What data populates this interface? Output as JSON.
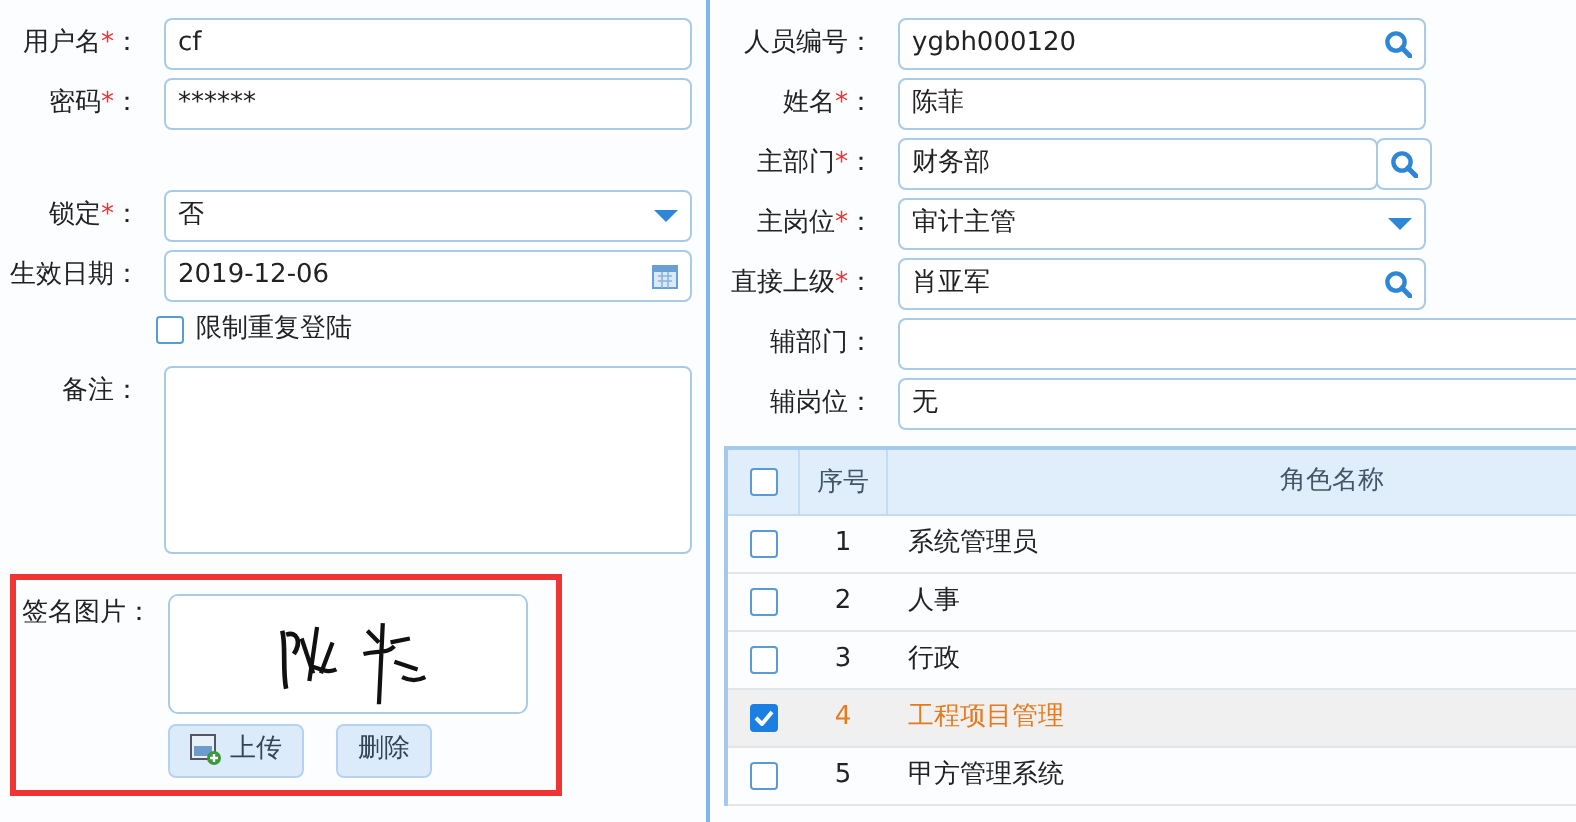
{
  "left_form": {
    "fields": [
      {
        "kind": "text",
        "label": "用户名",
        "required_mark": "*",
        "suffix": "：",
        "value": "cf"
      },
      {
        "kind": "password",
        "label": "密码",
        "required_mark": "*",
        "suffix": "：",
        "value": "******"
      },
      {
        "kind": "spacer"
      },
      {
        "kind": "select",
        "label": "锁定",
        "required_mark": "*",
        "suffix": "：",
        "value": "否"
      },
      {
        "kind": "date",
        "label": "生效日期",
        "suffix": "：",
        "value": "2019-12-06"
      },
      {
        "kind": "checkbox",
        "label": "限制重复登陆",
        "checked": false
      },
      {
        "kind": "textarea",
        "label": "备注",
        "suffix": "："
      }
    ],
    "signature": {
      "label": "签名图片：",
      "highlighted": true,
      "buttons": [
        {
          "kind": "upload",
          "label": "上传"
        },
        {
          "kind": "plain",
          "label": "删除"
        }
      ]
    }
  },
  "right_form": {
    "fields": [
      {
        "kind": "lookup",
        "label": "人员编号",
        "suffix": "：",
        "value": "ygbh000120"
      },
      {
        "kind": "text",
        "label": "姓名",
        "required_mark": "*",
        "suffix": "：",
        "value": "陈菲"
      },
      {
        "kind": "lookup_button",
        "label": "主部门",
        "required_mark": "*",
        "suffix": "：",
        "value": "财务部"
      },
      {
        "kind": "select",
        "label": "主岗位",
        "required_mark": "*",
        "suffix": "：",
        "value": "审计主管"
      },
      {
        "kind": "lookup",
        "label": "直接上级",
        "required_mark": "*",
        "suffix": "：",
        "value": "肖亚军"
      },
      {
        "kind": "wide",
        "label": "辅部门",
        "suffix": "："
      },
      {
        "kind": "wide",
        "label": "辅岗位",
        "suffix": "：",
        "value": "无"
      }
    ]
  },
  "role_table": {
    "all_checked": false,
    "columns": [
      "序号",
      "角色名称"
    ],
    "rows": [
      {
        "no": "1",
        "name": "系统管理员",
        "checked": false,
        "selected": false
      },
      {
        "no": "2",
        "name": "人事",
        "checked": false,
        "selected": false
      },
      {
        "no": "3",
        "name": "行政",
        "checked": false,
        "selected": false
      },
      {
        "no": "4",
        "name": "工程项目管理",
        "checked": true,
        "selected": true
      },
      {
        "no": "5",
        "name": "甲方管理系统",
        "checked": false,
        "selected": false
      }
    ]
  }
}
